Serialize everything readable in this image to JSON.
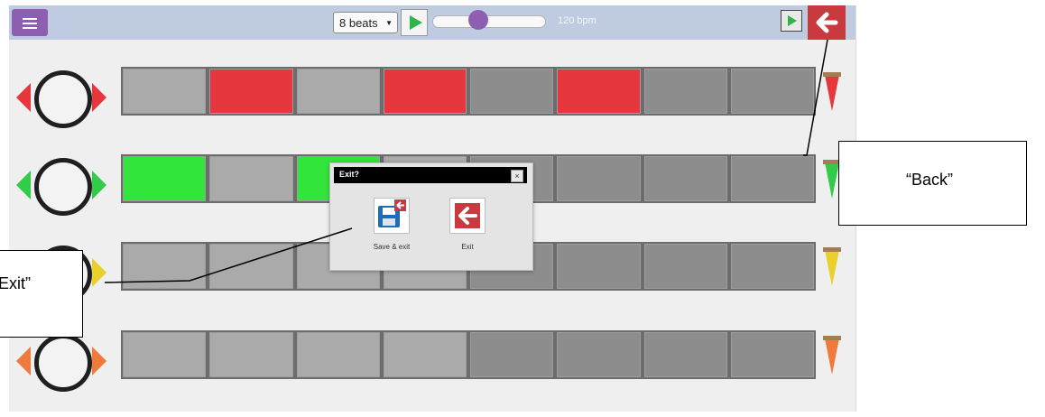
{
  "toolbar": {
    "menu_icon": "hamburger-menu-icon",
    "beats_select_value": "8 beats",
    "play_icon": "play-icon",
    "tempo_label": "120 bpm",
    "tempo_fraction": 0.38,
    "video_icon": "video-icon",
    "back_icon": "back-arrow-icon"
  },
  "tracks": [
    {
      "instrument_icon": "bass-drum-icon",
      "arrow_color": "#e5373d",
      "volume_color": "#e5373d",
      "active_color": "#e5373d",
      "cells": [
        false,
        true,
        false,
        true,
        false,
        true,
        false,
        false
      ]
    },
    {
      "instrument_icon": "snare-drum-icon",
      "arrow_color": "#33cc4a",
      "volume_color": "#33cc4a",
      "active_color": "#33e43b",
      "cells": [
        true,
        false,
        true,
        false,
        false,
        false,
        false,
        false
      ]
    },
    {
      "instrument_icon": "hidden-instrument-icon",
      "arrow_color": "#e9d02a",
      "volume_color": "#e9d02a",
      "active_color": "#e9d02a",
      "cells": [
        false,
        false,
        false,
        false,
        false,
        false,
        false,
        false
      ]
    },
    {
      "instrument_icon": "clapping-hands-icon",
      "arrow_color": "#ef7a3c",
      "volume_color": "#ef7a3c",
      "active_color": "#ef7a3c",
      "cells": [
        false,
        false,
        false,
        false,
        false,
        false,
        false,
        false
      ]
    }
  ],
  "dialog": {
    "title": "Exit?",
    "close_label": "×",
    "save_exit_label": "Save & exit",
    "exit_label": "Exit"
  },
  "annotations": {
    "back": "“Back”",
    "exit": "Exit”"
  }
}
